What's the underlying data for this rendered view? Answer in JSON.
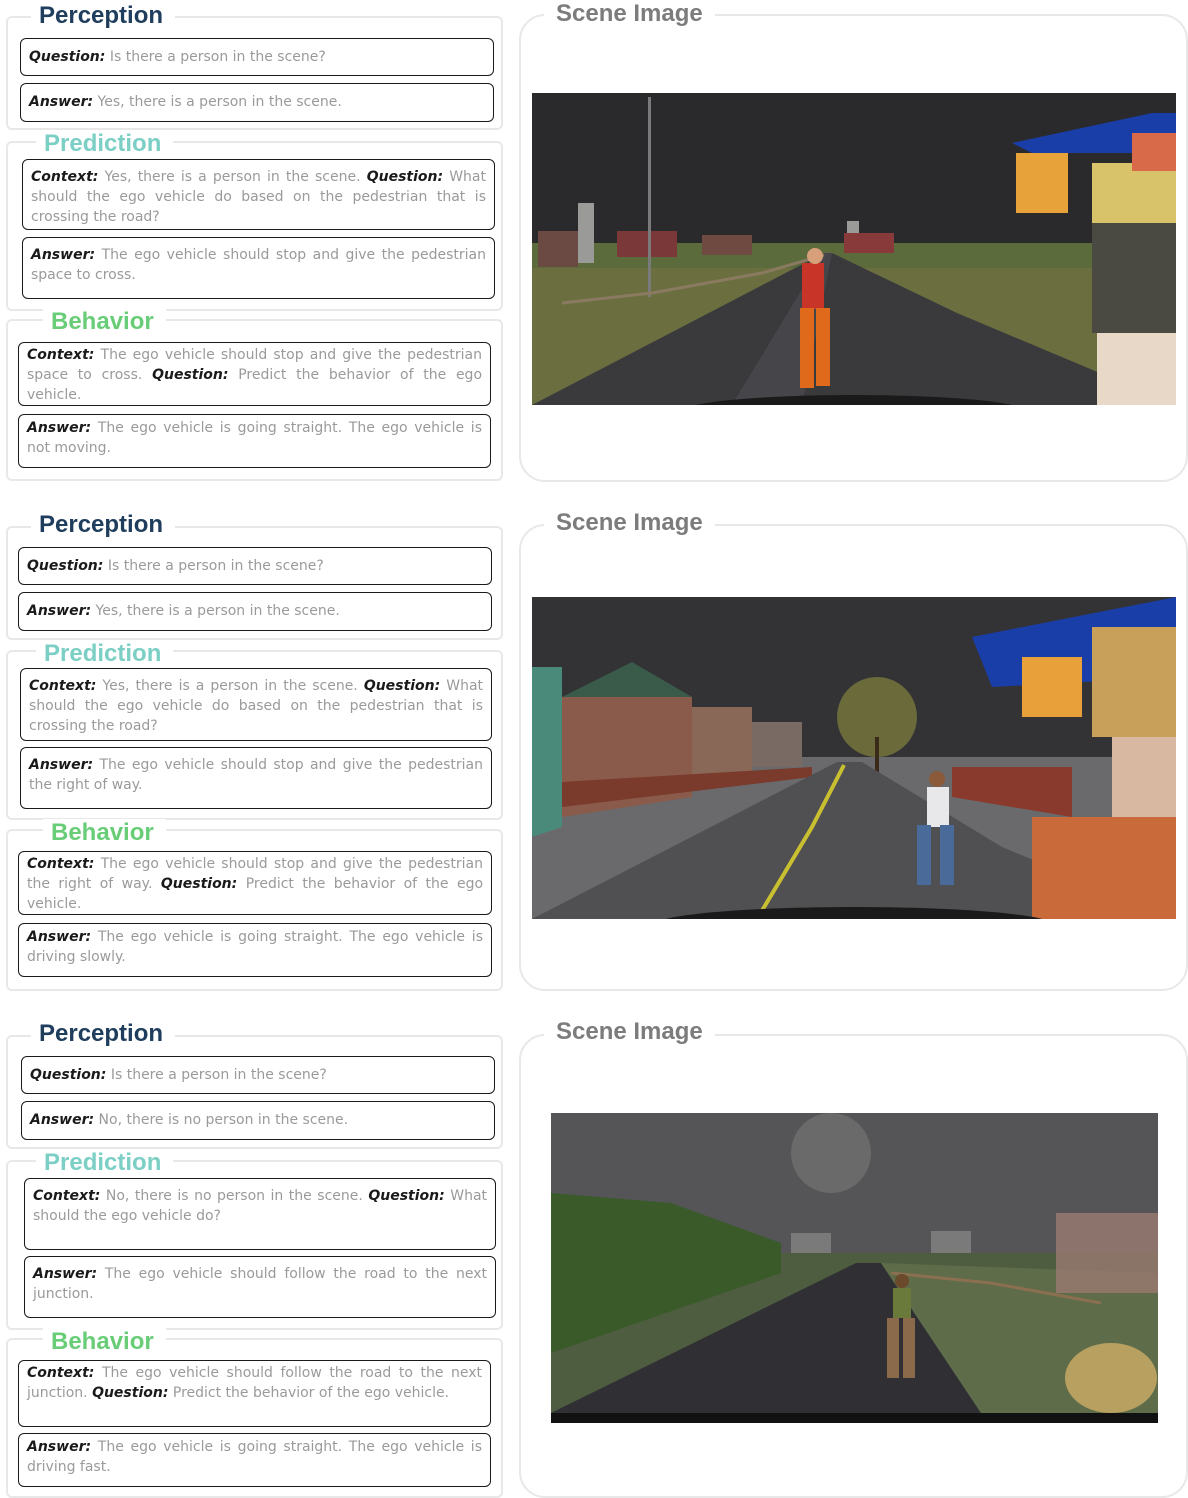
{
  "panels": [
    {
      "perception": {
        "title": "Perception",
        "question_label": "Question:",
        "question": "Is there a person in the scene?",
        "answer_label": "Answer:",
        "answer": "Yes, there is a person in the scene."
      },
      "prediction": {
        "title": "Prediction",
        "context_label": "Context:",
        "context": "Yes, there is a person in the scene.",
        "question_label": "Question:",
        "question": "What should the ego vehicle do based on the pedestrian that is crossing the road?",
        "answer_label": "Answer:",
        "answer": "The ego vehicle should stop and give the pedestrian space to cross."
      },
      "behavior": {
        "title": "Behavior",
        "context_label": "Context:",
        "context": "The ego vehicle should stop and give the pedestrian space to cross.",
        "question_label": "Question:",
        "question": "Predict the behavior of the ego vehicle.",
        "answer_label": "Answer:",
        "answer": "The ego vehicle is going straight. The ego vehicle is not moving."
      },
      "scene_title": "Scene Image",
      "scene_description": "rural road, woman in red top crossing, food cart on right"
    },
    {
      "perception": {
        "title": "Perception",
        "question_label": "Question:",
        "question": "Is there a person in the scene?",
        "answer_label": "Answer:",
        "answer": "Yes, there is a person in the scene."
      },
      "prediction": {
        "title": "Prediction",
        "context_label": "Context:",
        "context": "Yes, there is a person in the scene.",
        "question_label": "Question:",
        "question": "What should the ego vehicle do based on the pedestrian that is crossing the road?",
        "answer_label": "Answer:",
        "answer": "The ego vehicle should stop and give the pedestrian the right of way."
      },
      "behavior": {
        "title": "Behavior",
        "context_label": "Context:",
        "context": "The ego vehicle should stop and give the pedestrian the right of way.",
        "question_label": "Question:",
        "question": "Predict the behavior of the ego vehicle.",
        "answer_label": "Answer:",
        "answer": "The ego vehicle is going straight. The ego vehicle is driving slowly."
      },
      "scene_title": "Scene Image",
      "scene_description": "town street with houses, man crossing, food stall on right"
    },
    {
      "perception": {
        "title": "Perception",
        "question_label": "Question:",
        "question": "Is there a person in the scene?",
        "answer_label": "Answer:",
        "answer": "No, there is no person in the scene."
      },
      "prediction": {
        "title": "Prediction",
        "context_label": "Context:",
        "context": "No, there is no person in the scene.",
        "question_label": "Question:",
        "question": "What should the ego vehicle do?",
        "answer_label": "Answer:",
        "answer": "The ego vehicle should follow the road to the next junction."
      },
      "behavior": {
        "title": "Behavior",
        "context_label": "Context:",
        "context": "The ego vehicle should follow the road to the next junction.",
        "question_label": "Question:",
        "question": "Predict the behavior of the ego vehicle.",
        "answer_label": "Answer:",
        "answer": "The ego vehicle is going straight. The ego vehicle is driving fast."
      },
      "scene_title": "Scene Image",
      "scene_description": "foggy rural road with crops, child at roadside, hay bale"
    }
  ]
}
